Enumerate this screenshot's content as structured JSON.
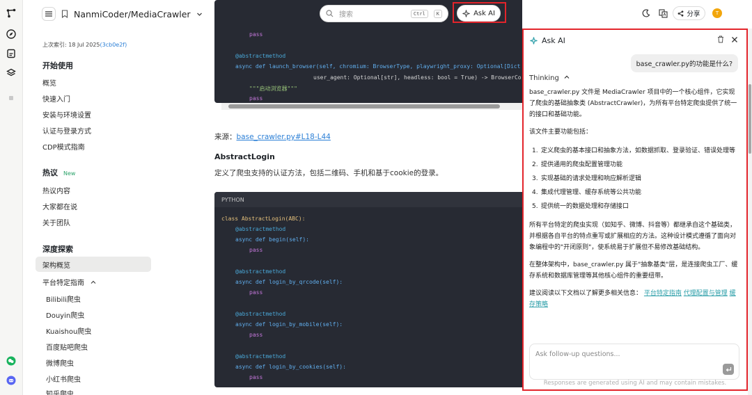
{
  "header": {
    "repo_name": "NanmiCoder/MediaCrawler",
    "search_placeholder": "搜索",
    "search_kbd_ctrl": "Ctrl",
    "search_kbd_k": "K",
    "ask_ai_label": "Ask AI",
    "share_label": "分享",
    "avatar_initial": "T"
  },
  "sidebar": {
    "indexed_prefix": "上次索引: 18 Jul 2025",
    "indexed_hash": "(3cb0e2f)",
    "groups": [
      {
        "title": "开始使用",
        "items": [
          "概览",
          "快速入门",
          "安装与环境设置",
          "认证与登录方式",
          "CDP模式指南"
        ]
      },
      {
        "title": "热议",
        "badge": "New",
        "items": [
          "热议内容",
          "大家都在说",
          "关于团队"
        ]
      },
      {
        "title": "深度探索",
        "items": [
          "架构概览",
          "平台特定指南"
        ]
      }
    ],
    "sub_items": [
      "Bilibili爬虫",
      "Douyin爬虫",
      "Kuaishou爬虫",
      "百度贴吧爬虫",
      "微博爬虫",
      "小红书爬虫",
      "知乎爬虫"
    ]
  },
  "main": {
    "top_code": {
      "lines": [
        "pass",
        "@abstractmethod",
        "async def launch_browser(self, chromium: BrowserType, playwright_proxy: Optional[Dict",
        "user_agent: Optional[str], headless: bool = True) -> BrowserCo",
        "\"\"\"启动浏览器\"\"\"",
        "pass"
      ]
    },
    "source_label": "来源：",
    "source_link": "base_crawler.py#L18-L44",
    "section_title": "AbstractLogin",
    "section_desc": "定义了爬虫支持的认证方法，包括二维码、手机和基于cookie的登录。",
    "code_lang": "PYTHON",
    "code_lines": [
      "class AbstractLogin(ABC):",
      "@abstractmethod",
      "async def begin(self):",
      "pass",
      "@abstractmethod",
      "async def login_by_qrcode(self):",
      "pass",
      "@abstractmethod",
      "async def login_by_mobile(self):",
      "pass",
      "@abstractmethod",
      "async def login_by_cookies(self):",
      "pass"
    ]
  },
  "ai_panel": {
    "title": "Ask AI",
    "user_question": "base_crawler.py的功能是什么?",
    "thinking_label": "Thinking",
    "intro": "base_crawler.py 文件是 MediaCrawler 项目中的一个核心组件，它实现了爬虫的基础抽象类 (AbstractCrawler)，为所有平台特定爬虫提供了统一的接口和基础功能。",
    "list_intro": "该文件主要功能包括：",
    "list": [
      "定义爬虫的基本接口和抽象方法，如数据抓取、登录验证、错误处理等",
      "提供通用的爬虫配置管理功能",
      "实现基础的请求处理和响应解析逻辑",
      "集成代理管理、缓存系统等公共功能",
      "提供统一的数据处理和存储接口"
    ],
    "para2": "所有平台特定的爬虫实现（如知乎、微博、抖音等）都继承自这个基础类，并根据各自平台的特点重写或扩展相应的方法。这种设计模式遵循了面向对象编程中的\"开闭原则\"，使系统易于扩展但不易修改基础结构。",
    "para3": "在整体架构中，base_crawler.py 属于\"抽象基类\"层，是连接爬虫工厂、缓存系统和数据库管理等其他核心组件的重要纽带。",
    "reading_prefix": "建议阅读以下文档以了解更多相关信息：",
    "reading_links": [
      "平台特定指南",
      "代理配置与管理",
      "缓存策略"
    ],
    "followup_placeholder": "Ask follow-up questions...",
    "disclaimer": "Responses are generated using AI and may contain mistakes."
  }
}
